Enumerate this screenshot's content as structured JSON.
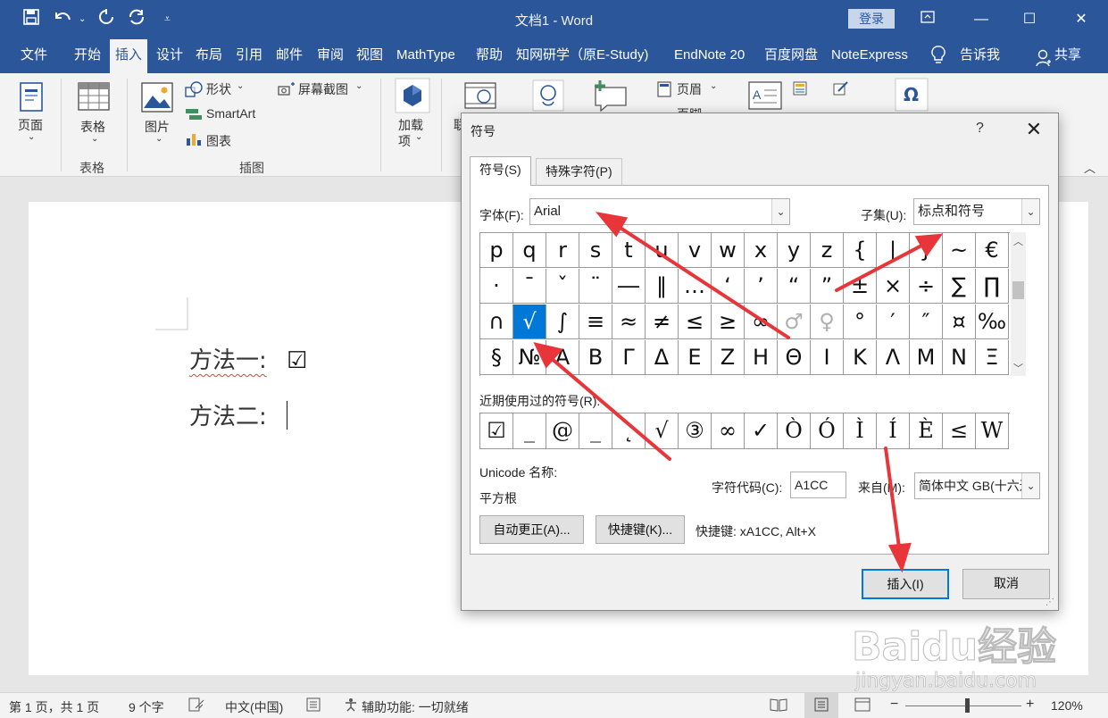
{
  "titlebar": {
    "title": "文档1  -  Word",
    "login": "登录",
    "icons": [
      "save-icon",
      "undo-icon",
      "repeat-icon",
      "refresh-icon",
      "customize-icon"
    ]
  },
  "menubar": {
    "tabs": [
      "文件",
      "开始",
      "插入",
      "设计",
      "布局",
      "引用",
      "邮件",
      "审阅",
      "视图",
      "MathType",
      "帮助",
      "知网研学（原E-Study)",
      "EndNote 20",
      "百度网盘",
      "NoteExpress",
      "告诉我",
      "共享"
    ],
    "active": "插入"
  },
  "ribbon": {
    "page": "页面",
    "table": "表格",
    "table_group": "表格",
    "picture": "图片",
    "shapes": "形状",
    "smartart": "SmartArt",
    "chart": "图表",
    "screenshot": "屏幕截图",
    "illustrations_group": "插图",
    "addins": "加载",
    "addins2": "项",
    "link_cut": "联",
    "header": "页眉",
    "footer_cut": "页脚"
  },
  "document": {
    "line1_label": "方法一:",
    "line1_symbol": "☑",
    "line2_label": "方法二:"
  },
  "statusbar": {
    "page": "第 1 页，共 1 页",
    "words": "9 个字",
    "language": "中文(中国)",
    "accessibility": "辅助功能: 一切就绪",
    "zoom": "120%",
    "minus": "−",
    "plus": "+"
  },
  "dialog": {
    "title": "符号",
    "help": "?",
    "close": "✕",
    "tab_symbols": "符号(S)",
    "tab_special": "特殊字符(P)",
    "font_label": "字体(F):",
    "font_value": "Arial",
    "subset_label": "子集(U):",
    "subset_value": "标点和符号",
    "symbol_rows": [
      [
        "p",
        "q",
        "r",
        "s",
        "t",
        "u",
        "v",
        "w",
        "x",
        "y",
        "z",
        "{",
        "|",
        "}",
        "~",
        "€"
      ],
      [
        "·",
        "ˉ",
        "ˇ",
        "¨",
        "―",
        "‖",
        "…",
        "‘",
        "’",
        "“",
        "”",
        "±",
        "×",
        "÷",
        "∑",
        "∏"
      ],
      [
        "∩",
        "√",
        "∫",
        "≡",
        "≈",
        "≠",
        "≤",
        "≥",
        "∞",
        "♂",
        "♀",
        "°",
        "′",
        "″",
        "¤",
        "‰"
      ],
      [
        "§",
        "№",
        "Α",
        "Β",
        "Γ",
        "Δ",
        "Ε",
        "Ζ",
        "Η",
        "Θ",
        "Ι",
        "Κ",
        "Λ",
        "Μ",
        "Ν",
        "Ξ"
      ]
    ],
    "selected_symbol": "√",
    "recent_label": "近期使用过的符号(R):",
    "recent": [
      "☑",
      "_",
      "@",
      "_",
      "˛",
      "√",
      "③",
      "∞",
      "✓",
      "Ò",
      "Ó",
      "Ì",
      "Í",
      "È",
      "≤",
      "W"
    ],
    "unicode_label": "Unicode 名称:",
    "unicode_name": "平方根",
    "charcode_label": "字符代码(C):",
    "charcode_value": "A1CC",
    "from_label": "来自(M):",
    "from_value": "简体中文 GB(十六进制)",
    "autocorrect_button": "自动更正(A)...",
    "shortcut_button": "快捷键(K)...",
    "shortcut_text": "快捷键: xA1CC, Alt+X",
    "insert_button": "插入(I)",
    "cancel_button": "取消"
  },
  "watermark": {
    "brand": "Baidu经验",
    "url": "jingyan.baidu.com"
  },
  "colors": {
    "accent": "#2b579a",
    "selection": "#0078d7",
    "arrow": "#e8353a"
  }
}
